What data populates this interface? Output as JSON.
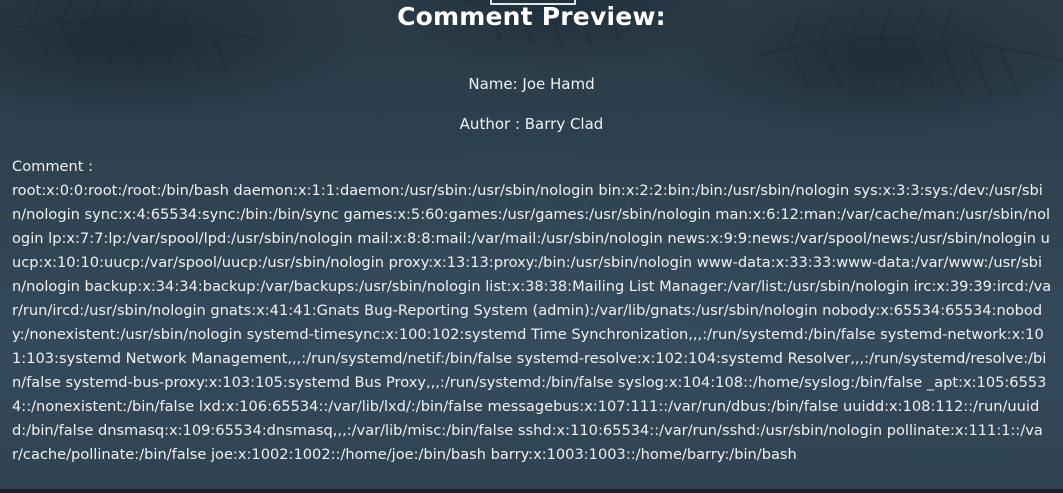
{
  "preview": {
    "title": "Comment Preview:",
    "name_line": "Name: Joe Hamd",
    "author_line": "Author : Barry Clad",
    "comment_label": "Comment :",
    "comment_body": "root:x:0:0:root:/root:/bin/bash daemon:x:1:1:daemon:/usr/sbin:/usr/sbin/nologin bin:x:2:2:bin:/bin:/usr/sbin/nologin sys:x:3:3:sys:/dev:/usr/sbin/nologin sync:x:4:65534:sync:/bin:/bin/sync games:x:5:60:games:/usr/games:/usr/sbin/nologin man:x:6:12:man:/var/cache/man:/usr/sbin/nologin lp:x:7:7:lp:/var/spool/lpd:/usr/sbin/nologin mail:x:8:8:mail:/var/mail:/usr/sbin/nologin news:x:9:9:news:/var/spool/news:/usr/sbin/nologin uucp:x:10:10:uucp:/var/spool/uucp:/usr/sbin/nologin proxy:x:13:13:proxy:/bin:/usr/sbin/nologin www-data:x:33:33:www-data:/var/www:/usr/sbin/nologin backup:x:34:34:backup:/var/backups:/usr/sbin/nologin list:x:38:38:Mailing List Manager:/var/list:/usr/sbin/nologin irc:x:39:39:ircd:/var/run/ircd:/usr/sbin/nologin gnats:x:41:41:Gnats Bug-Reporting System (admin):/var/lib/gnats:/usr/sbin/nologin nobody:x:65534:65534:nobody:/nonexistent:/usr/sbin/nologin systemd-timesync:x:100:102:systemd Time Synchronization,,,:/run/systemd:/bin/false systemd-network:x:101:103:systemd Network Management,,,:/run/systemd/netif:/bin/false systemd-resolve:x:102:104:systemd Resolver,,,:/run/systemd/resolve:/bin/false systemd-bus-proxy:x:103:105:systemd Bus Proxy,,,:/run/systemd:/bin/false syslog:x:104:108::/home/syslog:/bin/false _apt:x:105:65534::/nonexistent:/bin/false lxd:x:106:65534::/var/lib/lxd/:/bin/false messagebus:x:107:111::/var/run/dbus:/bin/false uuidd:x:108:112::/run/uuidd:/bin/false dnsmasq:x:109:65534:dnsmasq,,,:/var/lib/misc:/bin/false sshd:x:110:65534::/var/run/sshd:/usr/sbin/nologin pollinate:x:111:1::/var/cache/pollinate:/bin/false joe:x:1002:1002::/home/joe:/bin/bash barry:x:1003:1003::/home/barry:/bin/bash"
  },
  "colors": {
    "background": "#2e4250",
    "text": "#eef2f4",
    "title": "#ffffff"
  }
}
